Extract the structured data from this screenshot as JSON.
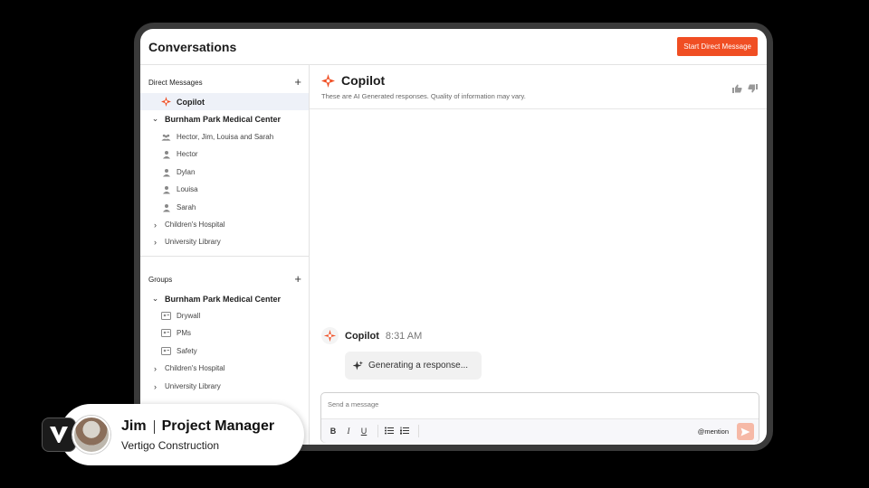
{
  "header": {
    "title": "Conversations",
    "start_dm_label": "Start Direct Message"
  },
  "sidebar": {
    "dm_title": "Direct Messages",
    "copilot_label": "Copilot",
    "dm_groups": [
      {
        "label": "Burnham Park Medical Center",
        "expanded": true,
        "children": [
          "Hector, Jim, Louisa and Sarah",
          "Hector",
          "Dylan",
          "Louisa",
          "Sarah"
        ]
      },
      {
        "label": "Children's Hospital",
        "expanded": false
      },
      {
        "label": "University Library",
        "expanded": false
      }
    ],
    "groups_title": "Groups",
    "group_groups": [
      {
        "label": "Burnham Park Medical Center",
        "expanded": true,
        "children": [
          "Drywall",
          "PMs",
          "Safety"
        ]
      },
      {
        "label": "Children's Hospital",
        "expanded": false
      },
      {
        "label": "University Library",
        "expanded": false
      }
    ]
  },
  "main": {
    "title": "Copilot",
    "subtitle": "These are AI Generated responses. Quality of information may vary.",
    "message": {
      "sender": "Copilot",
      "time": "8:31 AM",
      "text": "Generating a response..."
    },
    "composer": {
      "placeholder": "Send a message",
      "mention": "@mention",
      "format_buttons": [
        "B",
        "I",
        "U"
      ]
    }
  },
  "lower_third": {
    "name": "Jim",
    "role": "Project Manager",
    "company": "Vertigo Construction"
  },
  "colors": {
    "accent": "#f04e23",
    "send_disabled": "#f6b9a7"
  }
}
